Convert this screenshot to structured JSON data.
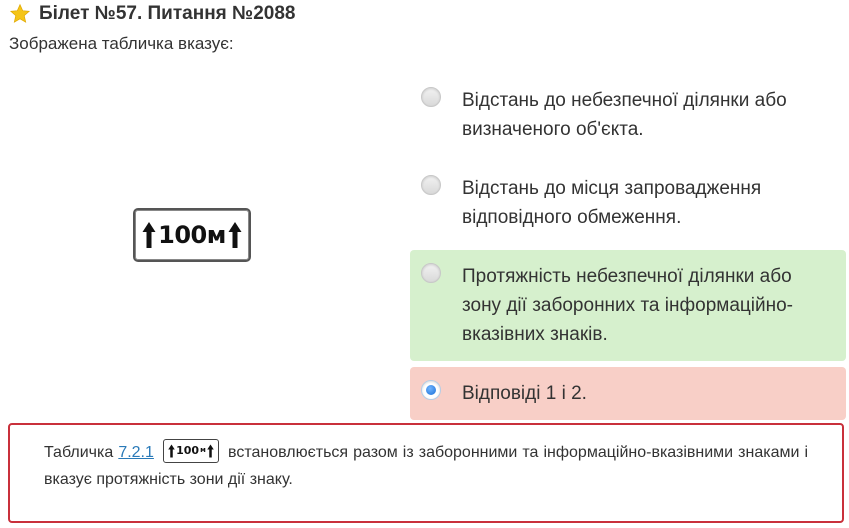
{
  "header": {
    "title": "Білет №57. Питання №2088",
    "star_color": "#f5c518"
  },
  "question": {
    "text": "Зображена табличка вказує:"
  },
  "sign": {
    "number": "100",
    "unit": "м"
  },
  "answers": [
    {
      "text": "Відстань до небезпечної ділянки або визначеного об'єкта.",
      "state": "normal",
      "selected": false
    },
    {
      "text": "Відстань до місця запровадження відповідного обмеження.",
      "state": "normal",
      "selected": false
    },
    {
      "text": "Протяжність небезпечної ділянки або зону дії заборонних та інформаційно-вказівних знаків.",
      "state": "correct",
      "selected": false
    },
    {
      "text": "Відповіді 1 і 2.",
      "state": "wrong",
      "selected": true
    }
  ],
  "explanation": {
    "prefix": "Табличка",
    "link_text": "7.2.1",
    "mini_sign_number": "100",
    "mini_sign_unit": "м",
    "suffix": "встановлюється разом із заборонними та інформаційно-вказівними знаками і вказує протяжність зони дії знаку."
  },
  "colors": {
    "correct_bg": "#d6f0cd",
    "wrong_bg": "#f8cfc7",
    "explain_border": "#c9303b",
    "link": "#2a7ab8"
  }
}
